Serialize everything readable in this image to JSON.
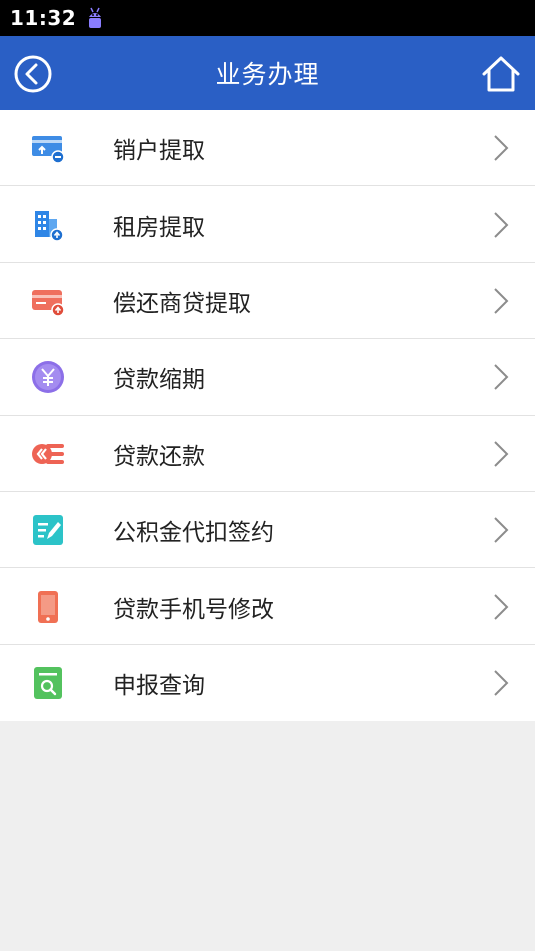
{
  "status_bar": {
    "time": "11:32",
    "notification_icon": "android-robot-icon"
  },
  "header": {
    "title": "业务办理",
    "back_icon": "back-circle-icon",
    "home_icon": "home-icon",
    "background_color": "#2a5fc5"
  },
  "menu": {
    "items": [
      {
        "label": "销户提取",
        "icon": "account-close-withdraw-icon",
        "color": "#3e8ce5"
      },
      {
        "label": "租房提取",
        "icon": "rent-building-icon",
        "color": "#2f86e6"
      },
      {
        "label": "偿还商贷提取",
        "icon": "repay-card-icon",
        "color": "#ef6f5e"
      },
      {
        "label": "贷款缩期",
        "icon": "yuan-coin-icon",
        "color": "#8c6fe8"
      },
      {
        "label": "贷款还款",
        "icon": "loan-repay-list-icon",
        "color": "#ee6354"
      },
      {
        "label": "公积金代扣签约",
        "icon": "sign-pen-icon",
        "color": "#2cc3c8"
      },
      {
        "label": "贷款手机号修改",
        "icon": "mobile-phone-icon",
        "color": "#f07054"
      },
      {
        "label": "申报查询",
        "icon": "document-search-icon",
        "color": "#53c25e"
      }
    ],
    "chevron_icon": "chevron-right-icon"
  }
}
